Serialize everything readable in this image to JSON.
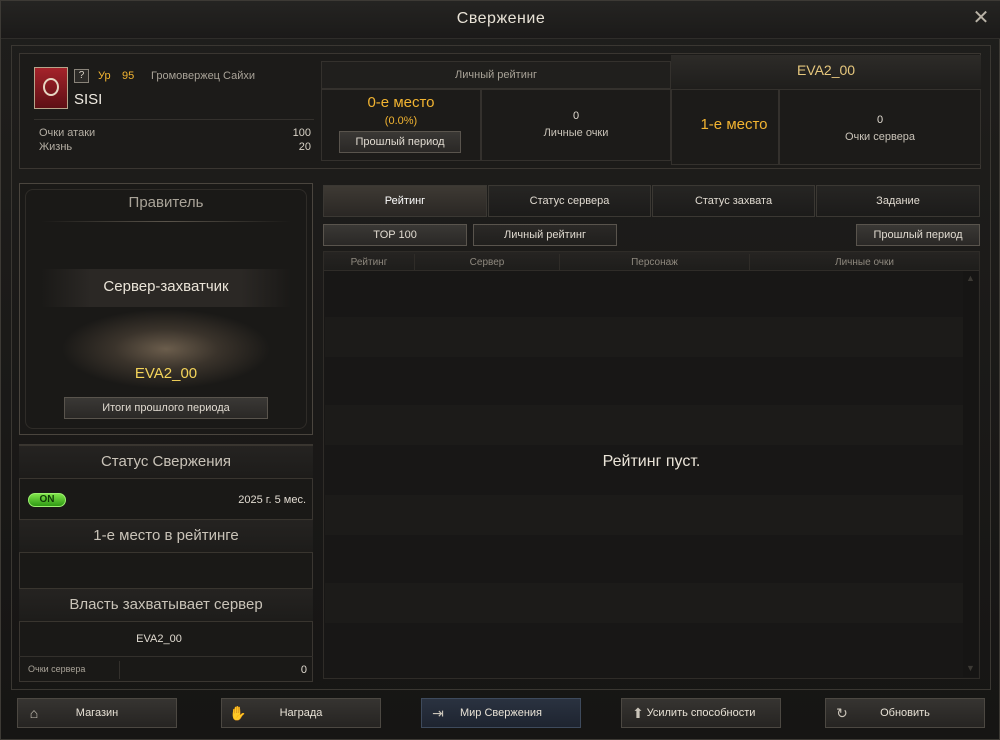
{
  "window": {
    "title": "Свержение"
  },
  "character": {
    "level_prefix": "Ур",
    "level": "95",
    "class_name": "Громовержец Сайхи",
    "name": "SISI",
    "stats": [
      {
        "label": "Очки атаки",
        "value": "100"
      },
      {
        "label": "Жизнь",
        "value": "20"
      }
    ]
  },
  "personal_rating": {
    "header": "Личный рейтинг",
    "place": "0-е место",
    "percent": "(0.0%)",
    "prev_button": "Прошлый период",
    "points_value": "0",
    "points_label": "Личные очки"
  },
  "server_rating": {
    "server_name": "EVA2_00",
    "place": "1-е место",
    "points_value": "0",
    "points_label": "Очки сервера"
  },
  "ruler": {
    "header": "Правитель",
    "subheader": "Сервер-захватчик",
    "server": "EVA2_00",
    "results_button": "Итоги прошлого периода"
  },
  "status": {
    "header": "Статус Свержения",
    "toggle": "ON",
    "date": "2025 г. 5 мес.",
    "rank_text": "1-е место в рейтинге",
    "power_header": "Власть захватывает сервер",
    "power_server": "EVA2_00",
    "server_points_label": "Очки сервера",
    "server_points_value": "0"
  },
  "tabs": [
    "Рейтинг",
    "Статус сервера",
    "Статус захвата",
    "Задание"
  ],
  "subtabs": {
    "top": "TOP 100",
    "personal": "Личный рейтинг",
    "prev": "Прошлый период"
  },
  "table": {
    "columns": [
      "Рейтинг",
      "Сервер",
      "Персонаж",
      "Личные очки"
    ],
    "empty_text": "Рейтинг пуст."
  },
  "footer": [
    {
      "label": "Магазин",
      "icon": "shop-icon"
    },
    {
      "label": "Награда",
      "icon": "reward-icon"
    },
    {
      "label": "Мир Свержения",
      "icon": "portal-icon"
    },
    {
      "label": "Усилить способности",
      "icon": "upgrade-icon"
    },
    {
      "label": "Обновить",
      "icon": "refresh-icon"
    }
  ]
}
